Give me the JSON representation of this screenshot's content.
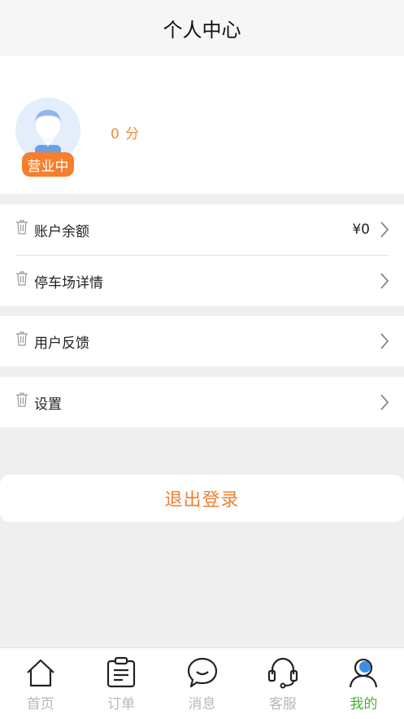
{
  "header": {
    "title": "个人中心"
  },
  "profile": {
    "status_badge": "营业中",
    "points": "0 分"
  },
  "menu": {
    "account_balance": {
      "label": "账户余额",
      "value": "¥0"
    },
    "parking_details": {
      "label": "停车场详情"
    },
    "feedback": {
      "label": "用户反馈"
    },
    "settings": {
      "label": "设置"
    }
  },
  "logout": {
    "label": "退出登录"
  },
  "tabbar": {
    "items": [
      {
        "label": "首页",
        "icon": "home-icon"
      },
      {
        "label": "订单",
        "icon": "clipboard-icon"
      },
      {
        "label": "消息",
        "icon": "chat-bubble-icon"
      },
      {
        "label": "客服",
        "icon": "headset-icon"
      },
      {
        "label": "我的",
        "icon": "user-icon",
        "active": true
      }
    ]
  },
  "colors": {
    "accent": "#f57f2e",
    "active_tab": "#4caf35",
    "active_icon": "#3b8ee6"
  }
}
